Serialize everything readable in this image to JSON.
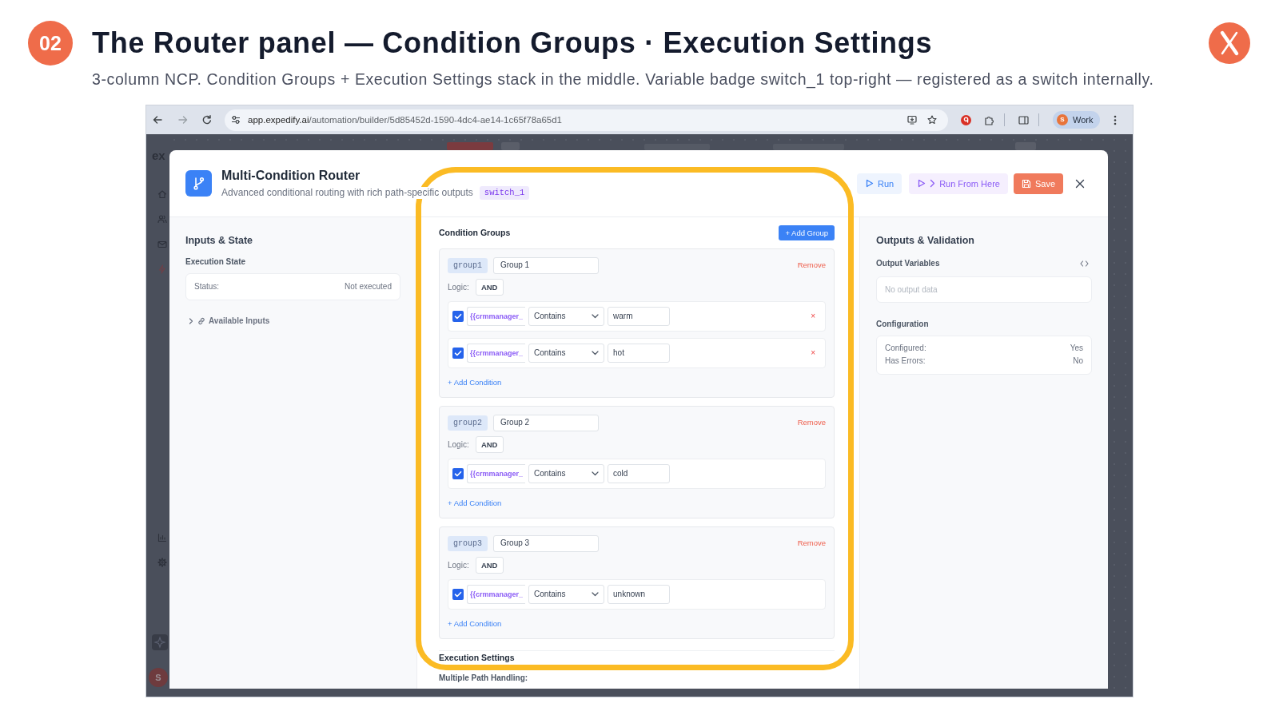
{
  "slide": {
    "number": "02",
    "title": "The Router panel — Condition Groups · Execution Settings",
    "subtitle": "3-column NCP. Condition Groups + Execution Settings stack in the middle. Variable badge switch_1 top-right — registered as a switch internally."
  },
  "browser": {
    "url_host": "app.expedify.ai",
    "url_path": "/automation/builder/5d85452d-1590-4dc4-ae14-1c65f78a65d1",
    "forward_disabled": true,
    "profile_initial": "S",
    "profile_label": "Work"
  },
  "background_app": {
    "logo_text": "ex",
    "avatar_initial": "S"
  },
  "modal": {
    "title": "Multi-Condition Router",
    "subtitle": "Advanced conditional routing with rich path-specific outputs",
    "variable_badge": "switch_1",
    "actions": [
      {
        "kind": "run",
        "label": "Run"
      },
      {
        "kind": "run_from_here",
        "label": "Run From Here"
      },
      {
        "kind": "save",
        "label": "Save"
      }
    ],
    "inputs_panel": {
      "title": "Inputs & State",
      "execution_state_label": "Execution State",
      "status_label": "Status:",
      "status_value": "Not executed",
      "available_inputs": {
        "label": "Available Inputs",
        "expanded": false
      }
    },
    "condition_groups": {
      "title": "Condition Groups",
      "add_button": "+ Add Group",
      "groups": [
        {
          "id": "group1",
          "name": "Group 1",
          "remove": "Remove",
          "logic_label": "Logic:",
          "logic": "AND",
          "conditions": [
            {
              "checked": true,
              "variable": "{{crmmanager_",
              "operator": "Contains",
              "value": "warm",
              "remove": "×"
            },
            {
              "checked": true,
              "variable": "{{crmmanager_",
              "operator": "Contains",
              "value": "hot",
              "remove": "×"
            }
          ],
          "add_condition": "+ Add Condition"
        },
        {
          "id": "group2",
          "name": "Group 2",
          "remove": "Remove",
          "logic_label": "Logic:",
          "logic": "AND",
          "conditions": [
            {
              "checked": true,
              "variable": "{{crmmanager_",
              "operator": "Contains",
              "value": "cold"
            }
          ],
          "add_condition": "+ Add Condition"
        },
        {
          "id": "group3",
          "name": "Group 3",
          "remove": "Remove",
          "logic_label": "Logic:",
          "logic": "AND",
          "conditions": [
            {
              "checked": true,
              "variable": "{{crmmanager_",
              "operator": "Contains",
              "value": "unknown"
            }
          ],
          "add_condition": "+ Add Condition"
        }
      ]
    },
    "execution_settings": {
      "title": "Execution Settings",
      "field_label": "Multiple Path Handling:"
    },
    "outputs_panel": {
      "title": "Outputs & Validation",
      "output_variables_label": "Output Variables",
      "empty_text": "No output data",
      "configuration_label": "Configuration",
      "rows": [
        {
          "label": "Configured:",
          "value": "Yes"
        },
        {
          "label": "Has Errors:",
          "value": "No"
        }
      ]
    }
  }
}
